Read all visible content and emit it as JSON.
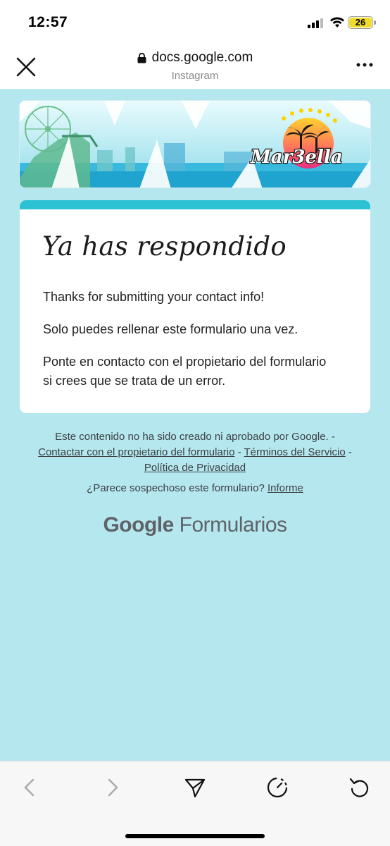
{
  "status_bar": {
    "time": "12:57",
    "battery_level": "26",
    "battery_color": "#f1dc2a"
  },
  "browser": {
    "url": "docs.google.com",
    "source_app": "Instagram",
    "close_icon": "close-icon",
    "more_icon": "more-horizontal-icon",
    "lock_icon": "lock-icon"
  },
  "banner": {
    "logo_text": "Mar3ella"
  },
  "card": {
    "title": "Ya has respondido",
    "message": "Thanks for submitting your contact info!",
    "line1": "Solo puedes rellenar este formulario una vez.",
    "line2": "Ponte en contacto con el propietario del formulario si crees que se trata de un error.",
    "accent_color": "#2cc1d3"
  },
  "footer": {
    "disclaimer": "Este contenido no ha sido creado ni aprobado por Google.",
    "sep": " - ",
    "contact_owner": "Contactar con el propietario del formulario",
    "terms": "Términos del Servicio",
    "privacy": "Política de Privacidad",
    "suspicious_text": "¿Parece sospechoso este formulario?",
    "report": "Informe",
    "brand_google": "Google",
    "brand_product": "Formularios"
  },
  "toolbar": {
    "back_icon": "chevron-left-icon",
    "forward_icon": "chevron-right-icon",
    "share_icon": "send-icon",
    "timer_icon": "timer-icon",
    "reload_icon": "reload-icon"
  },
  "page_background": "#b5e7ef"
}
